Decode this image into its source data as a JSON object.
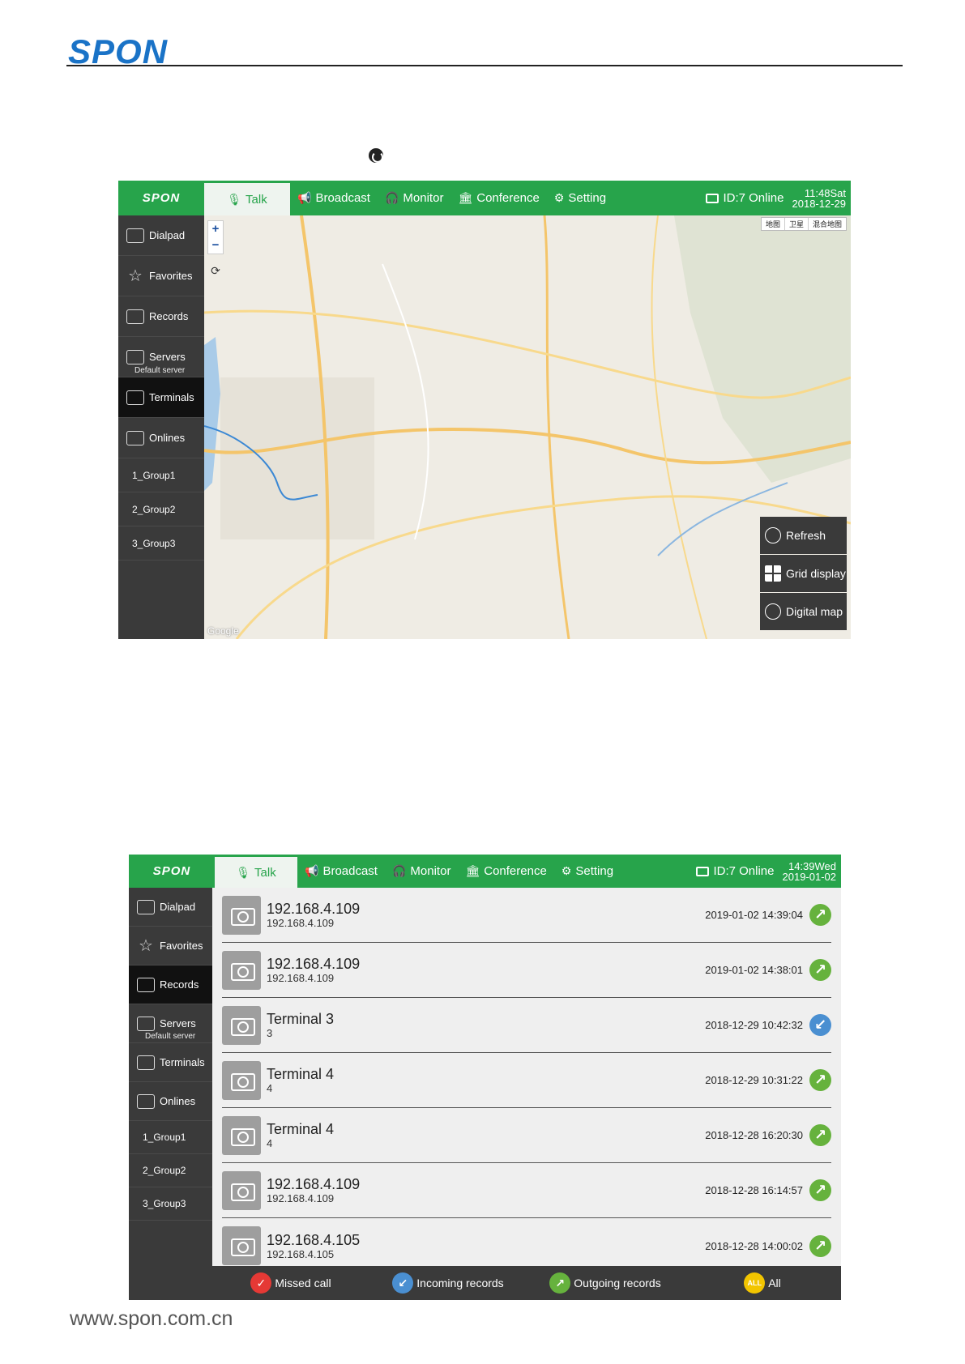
{
  "document": {
    "logo": "SPON",
    "footer": "www.spon.com.cn"
  },
  "screen1": {
    "logo": "SPON",
    "tabs": [
      {
        "label": "Talk",
        "icon": "microphone-icon"
      },
      {
        "label": "Broadcast",
        "icon": "megaphone-icon"
      },
      {
        "label": "Monitor",
        "icon": "headphones-icon"
      },
      {
        "label": "Conference",
        "icon": "conference-icon"
      },
      {
        "label": "Setting",
        "icon": "gear-icon"
      }
    ],
    "device_status": "ID:7 Online",
    "clock_time": "11:48Sat",
    "clock_date": "2018-12-29",
    "sidebar": [
      {
        "label": "Dialpad",
        "sub": ""
      },
      {
        "label": "Favorites",
        "sub": ""
      },
      {
        "label": "Records",
        "sub": ""
      },
      {
        "label": "Servers",
        "sub": "Default server"
      },
      {
        "label": "Terminals",
        "sub": ""
      },
      {
        "label": "Onlines",
        "sub": ""
      }
    ],
    "groups": [
      "1_Group1",
      "2_Group2",
      "3_Group3"
    ],
    "map": {
      "zoom_in": "+",
      "zoom_out": "−",
      "map_types": [
        "地图",
        "卫星",
        "混合地图"
      ],
      "brand": "Google",
      "panel": [
        {
          "label": "Refresh",
          "icon": "refresh-icon"
        },
        {
          "label": "Grid display",
          "icon": "grid-icon"
        },
        {
          "label": "Digital map",
          "icon": "map-pin-icon"
        }
      ]
    }
  },
  "screen2": {
    "logo": "SPON",
    "tabs": [
      {
        "label": "Talk",
        "icon": "microphone-icon"
      },
      {
        "label": "Broadcast",
        "icon": "megaphone-icon"
      },
      {
        "label": "Monitor",
        "icon": "headphones-icon"
      },
      {
        "label": "Conference",
        "icon": "conference-icon"
      },
      {
        "label": "Setting",
        "icon": "gear-icon"
      }
    ],
    "device_status": "ID:7 Online",
    "clock_time": "14:39Wed",
    "clock_date": "2019-01-02",
    "sidebar": [
      {
        "label": "Dialpad",
        "sub": ""
      },
      {
        "label": "Favorites",
        "sub": ""
      },
      {
        "label": "Records",
        "sub": ""
      },
      {
        "label": "Servers",
        "sub": "Default server"
      },
      {
        "label": "Terminals",
        "sub": ""
      },
      {
        "label": "Onlines",
        "sub": ""
      }
    ],
    "groups": [
      "1_Group1",
      "2_Group2",
      "3_Group3"
    ],
    "records": [
      {
        "name": "192.168.4.109",
        "sub": "192.168.4.109",
        "time": "2019-01-02 14:39:04",
        "type": "outgoing"
      },
      {
        "name": "192.168.4.109",
        "sub": "192.168.4.109",
        "time": "2019-01-02 14:38:01",
        "type": "outgoing"
      },
      {
        "name": "Terminal 3",
        "sub": "3",
        "time": "2018-12-29 10:42:32",
        "type": "incoming"
      },
      {
        "name": "Terminal 4",
        "sub": "4",
        "time": "2018-12-29 10:31:22",
        "type": "outgoing"
      },
      {
        "name": "Terminal 4",
        "sub": "4",
        "time": "2018-12-28 16:20:30",
        "type": "outgoing"
      },
      {
        "name": "192.168.4.109",
        "sub": "192.168.4.109",
        "time": "2018-12-28 16:14:57",
        "type": "outgoing"
      },
      {
        "name": "192.168.4.105",
        "sub": "192.168.4.105",
        "time": "2018-12-28 14:00:02",
        "type": "outgoing"
      }
    ],
    "filters": [
      {
        "label": "Missed call",
        "icon_text": "✓"
      },
      {
        "label": "Incoming records",
        "icon_text": "↙"
      },
      {
        "label": "Outgoing records",
        "icon_text": "↗"
      },
      {
        "label": "All",
        "icon_text": "ALL"
      }
    ],
    "colors": {
      "accent": "#27a44b",
      "outgoing": "#66b23d",
      "incoming": "#4a8fd1",
      "missed": "#e53935",
      "all": "#f2c500"
    }
  }
}
